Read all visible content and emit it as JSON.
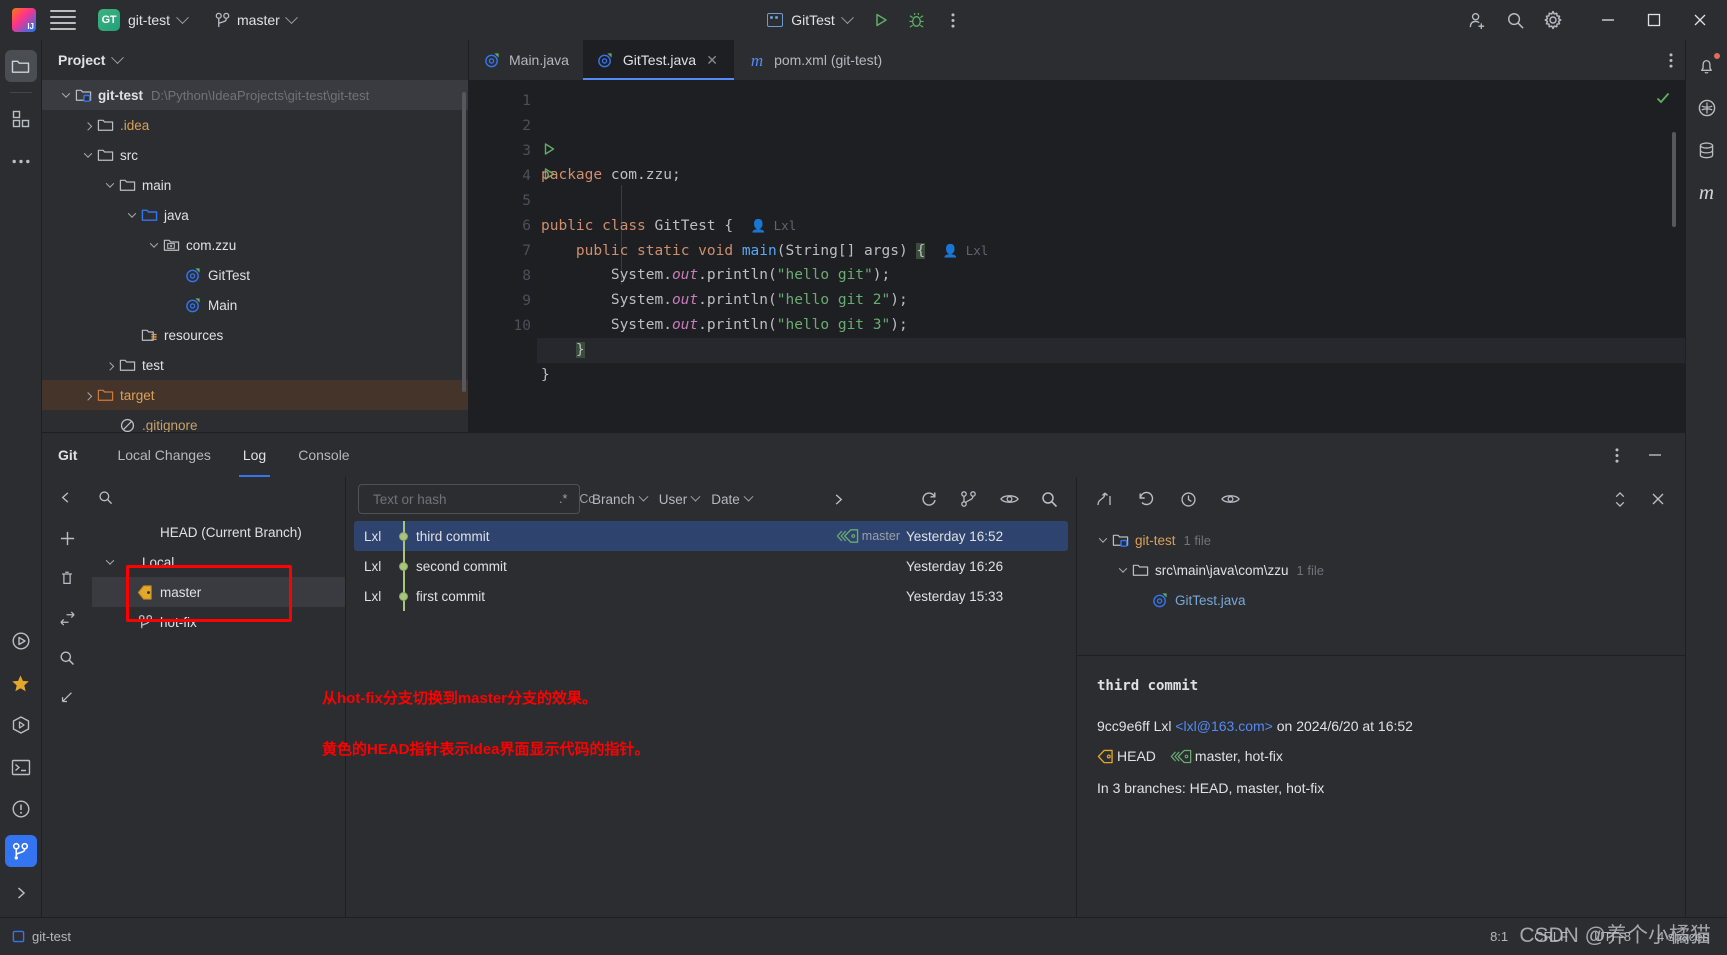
{
  "titlebar": {
    "logo": "intellij-idea-logo",
    "project_badge": "GT",
    "project_name": "git-test",
    "branch_name": "master",
    "run_config": "GitTest",
    "icons": [
      "run-icon",
      "debug-icon",
      "more-actions-icon",
      "add-collaborator-icon",
      "search-everywhere-icon",
      "settings-icon"
    ],
    "window_buttons": [
      "minimize",
      "maximize",
      "close"
    ]
  },
  "left_rail": {
    "items": [
      "project-icon",
      "structure-icon",
      "more-tool-windows-icon",
      "run-icon",
      "bookmarks-icon",
      "services-icon",
      "terminal-icon",
      "problems-icon",
      "git-icon",
      "expand-icon"
    ]
  },
  "right_rail": {
    "items": [
      "notifications-icon",
      "ai-assistant-icon",
      "database-icon",
      "maven-icon"
    ]
  },
  "project_panel": {
    "title": "Project",
    "tree": [
      {
        "label": "git-test",
        "path": "D:\\Python\\IdeaProjects\\git-test\\git-test",
        "indent": 0,
        "arrow": "down",
        "icon": "module-folder-icon",
        "bold": true,
        "selected": true
      },
      {
        "label": ".idea",
        "path": "",
        "indent": 1,
        "arrow": "right",
        "icon": "folder-icon",
        "color": "orange"
      },
      {
        "label": "src",
        "path": "",
        "indent": 1,
        "arrow": "down",
        "icon": "folder-icon"
      },
      {
        "label": "main",
        "path": "",
        "indent": 2,
        "arrow": "down",
        "icon": "folder-icon"
      },
      {
        "label": "java",
        "path": "",
        "indent": 3,
        "arrow": "down",
        "icon": "source-folder-icon"
      },
      {
        "label": "com.zzu",
        "path": "",
        "indent": 4,
        "arrow": "down",
        "icon": "package-icon"
      },
      {
        "label": "GitTest",
        "path": "",
        "indent": 5,
        "arrow": "none",
        "icon": "java-class-icon"
      },
      {
        "label": "Main",
        "path": "",
        "indent": 5,
        "arrow": "none",
        "icon": "java-class-icon"
      },
      {
        "label": "resources",
        "path": "",
        "indent": 3,
        "arrow": "none",
        "icon": "resources-folder-icon"
      },
      {
        "label": "test",
        "path": "",
        "indent": 2,
        "arrow": "right",
        "icon": "folder-icon"
      },
      {
        "label": "target",
        "path": "",
        "indent": 1,
        "arrow": "right",
        "icon": "excluded-folder-icon",
        "color": "orange",
        "highlight": true
      },
      {
        "label": ".gitignore",
        "path": "",
        "indent": 2,
        "arrow": "none",
        "icon": "gitignore-icon",
        "color": "gitignored"
      }
    ]
  },
  "editor": {
    "tabs": [
      {
        "label": "Main.java",
        "icon": "java-class-icon",
        "active": false,
        "closable": false
      },
      {
        "label": "GitTest.java",
        "icon": "java-class-icon",
        "active": true,
        "closable": true
      },
      {
        "label": "pom.xml (git-test)",
        "icon": "maven-icon",
        "active": false,
        "closable": false
      }
    ],
    "more_icon": "more-options-icon",
    "inspection_status": "ok-checkmark",
    "line_numbers": [
      "1",
      "2",
      "3",
      "4",
      "5",
      "6",
      "7",
      "8",
      "9",
      "10"
    ],
    "code_lines": [
      {
        "n": 1,
        "html": "<span class='kw'>package</span> com.zzu;"
      },
      {
        "n": 2,
        "html": ""
      },
      {
        "n": 3,
        "html": "<span class='kw'>public</span> <span class='kw'>class</span> GitTest {  <span class='hint'>&#128100; Lxl</span>",
        "runmarker": true
      },
      {
        "n": 4,
        "html": "    <span class='kw'>public</span> <span class='kw'>static</span> <span class='kw'>void</span> <span class='meth'>main</span>(String[] args) <span class='match-brace'>{</span>  <span class='hint'>&#128100; Lxl</span>",
        "runmarker": true
      },
      {
        "n": 5,
        "html": "        System.<span class='fld'>out</span>.println(<span class='str'>\"hello git\"</span>);"
      },
      {
        "n": 6,
        "html": "        System.<span class='fld'>out</span>.println(<span class='str'>\"hello git 2\"</span>);"
      },
      {
        "n": 7,
        "html": "        System.<span class='fld'>out</span>.println(<span class='str'>\"hello git 3\"</span>);"
      },
      {
        "n": 8,
        "html": "    <span class='match-brace'>}</span>",
        "cursor": true
      },
      {
        "n": 9,
        "html": "}"
      },
      {
        "n": 10,
        "html": ""
      }
    ]
  },
  "git_panel": {
    "title": "Git",
    "tabs": [
      {
        "label": "Local Changes",
        "active": false
      },
      {
        "label": "Log",
        "active": true
      },
      {
        "label": "Console",
        "active": false
      }
    ],
    "header_icons": [
      "more-options-icon",
      "minimize-icon"
    ],
    "branch_tree": {
      "toolbar_icons": [
        "collapse-icon",
        "search-icon"
      ],
      "side_icons": [
        "add-icon",
        "delete-icon",
        "checkout-icon",
        "search-icon",
        "import-icon"
      ],
      "rows": [
        {
          "label": "HEAD (Current Branch)",
          "indent": 1,
          "arrow": "none",
          "icon": "none"
        },
        {
          "label": "Local",
          "indent": 0,
          "arrow": "down",
          "icon": "none"
        },
        {
          "label": "master",
          "indent": 1,
          "arrow": "none",
          "icon": "head-tag-icon",
          "selected": true
        },
        {
          "label": "hot-fix",
          "indent": 1,
          "arrow": "none",
          "icon": "branch-icon"
        }
      ]
    },
    "log_toolbar": {
      "search_placeholder": "Text or hash",
      "search_value": "",
      "regex_label": ".*",
      "case_label": "Cc",
      "filters": [
        "Branch",
        "User",
        "Date"
      ],
      "expand_icon": "chevron-right-icon",
      "icons": [
        "refresh-icon",
        "show-branches-icon",
        "preview-diff-icon",
        "find-icon"
      ]
    },
    "commits": [
      {
        "author": "Lxl",
        "subject": "third commit",
        "ref": "master",
        "ref_icon": "branch-label-icon",
        "date": "Yesterday 16:52",
        "selected": true
      },
      {
        "author": "Lxl",
        "subject": "second commit",
        "ref": "",
        "date": "Yesterday 16:26",
        "selected": false
      },
      {
        "author": "Lxl",
        "subject": "first commit",
        "ref": "",
        "date": "Yesterday 15:33",
        "selected": false
      }
    ],
    "annotations": [
      "从hot-fix分支切换到master分支的效果。",
      "黄色的HEAD指针表示Idea界面显示代码的指针。"
    ],
    "details": {
      "toolbar_icons": [
        "group-by-icon",
        "revert-icon",
        "history-icon",
        "preview-icon",
        "expand-all-icon",
        "close-icon"
      ],
      "files": [
        {
          "label": "git-test",
          "count": "1 file",
          "indent": 0,
          "arrow": "down",
          "icon": "module-folder-icon",
          "color": "orange"
        },
        {
          "label": "src\\main\\java\\com\\zzu",
          "count": "1 file",
          "indent": 1,
          "arrow": "down",
          "icon": "folder-icon"
        },
        {
          "label": "GitTest.java",
          "count": "",
          "indent": 2,
          "arrow": "none",
          "icon": "java-class-icon",
          "color": "blue"
        }
      ],
      "subject": "third commit",
      "hash": "9cc9e6ff",
      "author": "Lxl",
      "email": "<lxl@163.com>",
      "date_text": "on 2024/6/20 at 16:52",
      "head_label": "HEAD",
      "refs_label": "master, hot-fix",
      "branches_text": "In 3 branches: HEAD, master, hot-fix"
    }
  },
  "statusbar": {
    "project_label": "git-test",
    "caret": "8:1",
    "line_sep": "CRLF",
    "encoding": "UTF-8",
    "indent": "4 spaces",
    "watermark": "CSDN @养个小橘猫"
  },
  "colors": {
    "accent_blue": "#3574f0",
    "selection_blue": "#2e436e",
    "annotation_red": "#ff0000",
    "branch_green": "#a9c47f",
    "head_yellow": "#e3a82b",
    "excluded_orange": "#d9a05b"
  }
}
